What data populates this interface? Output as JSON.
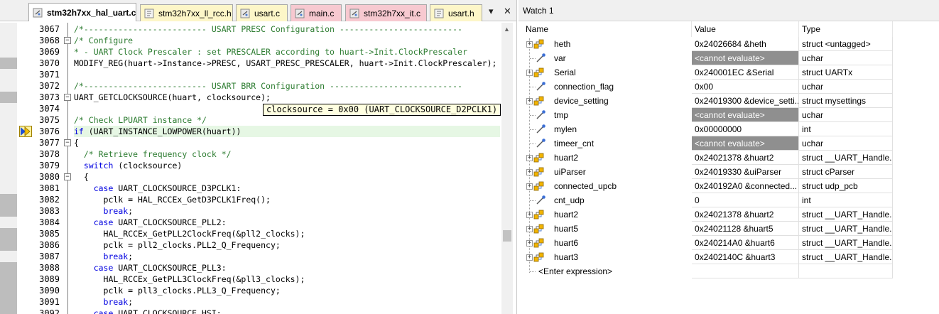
{
  "editor": {
    "tabs": [
      {
        "label": "stm32h7xx_hal_uart.c",
        "active": true
      },
      {
        "label": "stm32h7xx_ll_rcc.h",
        "active": false
      },
      {
        "label": "usart.c",
        "active": false
      },
      {
        "label": "main.c",
        "active": false
      },
      {
        "label": "stm32h7xx_it.c",
        "active": false
      },
      {
        "label": "usart.h",
        "active": false
      }
    ],
    "tab_tools": {
      "pin": "▾",
      "close": "✕"
    },
    "lines": [
      {
        "num": "3067",
        "text": "/*------------------------- USART PRESC Configuration -------------------------"
      },
      {
        "num": "3068",
        "text": "/* Configure"
      },
      {
        "num": "3069",
        "text": "* - UART Clock Prescaler : set PRESCALER according to huart->Init.ClockPrescaler"
      },
      {
        "num": "3070",
        "text": "MODIFY_REG(huart->Instance->PRESC, USART_PRESC_PRESCALER, huart->Init.ClockPrescaler);"
      },
      {
        "num": "3071",
        "text": ""
      },
      {
        "num": "3072",
        "text": "/*------------------------- USART BRR Configuration ---------------------------"
      },
      {
        "num": "3073",
        "text": "UART_GETCLOCKSOURCE(huart, clocksource);"
      },
      {
        "num": "3074",
        "text": ""
      },
      {
        "num": "3075",
        "text": "/* Check LPUART instance */"
      },
      {
        "num": "3076",
        "text": "if (UART_INSTANCE_LOWPOWER(huart))"
      },
      {
        "num": "3077",
        "text": "{"
      },
      {
        "num": "3078",
        "text": "  /* Retrieve frequency clock */"
      },
      {
        "num": "3079",
        "text": "  switch (clocksource)"
      },
      {
        "num": "3080",
        "text": "  {"
      },
      {
        "num": "3081",
        "text": "    case UART_CLOCKSOURCE_D3PCLK1:"
      },
      {
        "num": "3082",
        "text": "      pclk = HAL_RCCEx_GetD3PCLK1Freq();"
      },
      {
        "num": "3083",
        "text": "      break;"
      },
      {
        "num": "3084",
        "text": "    case UART_CLOCKSOURCE_PLL2:"
      },
      {
        "num": "3085",
        "text": "      HAL_RCCEx_GetPLL2ClockFreq(&pll2_clocks);"
      },
      {
        "num": "3086",
        "text": "      pclk = pll2_clocks.PLL2_Q_Frequency;"
      },
      {
        "num": "3087",
        "text": "      break;"
      },
      {
        "num": "3088",
        "text": "    case UART_CLOCKSOURCE_PLL3:"
      },
      {
        "num": "3089",
        "text": "      HAL_RCCEx_GetPLL3ClockFreq(&pll3_clocks);"
      },
      {
        "num": "3090",
        "text": "      pclk = pll3_clocks.PLL3_Q_Frequency;"
      },
      {
        "num": "3091",
        "text": "      break;"
      },
      {
        "num": "3092",
        "text": "    case UART_CLOCKSOURCE_HSI:"
      }
    ],
    "tooltip": "clocksource = 0x00 (UART_CLOCKSOURCE_D2PCLK1)"
  },
  "watch": {
    "title": "Watch 1",
    "columns": {
      "name": "Name",
      "value": "Value",
      "type": "Type"
    },
    "rows": [
      {
        "name": "heth",
        "value": "0x24026684 &heth",
        "type": "struct <untagged>",
        "expandable": true,
        "error": false
      },
      {
        "name": "var",
        "value": "<cannot evaluate>",
        "type": "uchar",
        "expandable": false,
        "error": true
      },
      {
        "name": "Serial",
        "value": "0x240001EC &Serial",
        "type": "struct UARTx",
        "expandable": true,
        "error": false
      },
      {
        "name": "connection_flag",
        "value": "0x00",
        "type": "uchar",
        "expandable": false,
        "error": false
      },
      {
        "name": "device_setting",
        "value": "0x24019300 &device_setti...",
        "type": "struct mysettings",
        "expandable": true,
        "error": false
      },
      {
        "name": "tmp",
        "value": "<cannot evaluate>",
        "type": "uchar",
        "expandable": false,
        "error": true
      },
      {
        "name": "mylen",
        "value": "0x00000000",
        "type": "int",
        "expandable": false,
        "error": false
      },
      {
        "name": "timeer_cnt",
        "value": "<cannot evaluate>",
        "type": "uchar",
        "expandable": false,
        "error": true
      },
      {
        "name": "huart2",
        "value": "0x24021378 &huart2",
        "type": "struct __UART_Handle...",
        "expandable": true,
        "error": false
      },
      {
        "name": "uiParser",
        "value": "0x24019330 &uiParser",
        "type": "struct cParser",
        "expandable": true,
        "error": false
      },
      {
        "name": "connected_upcb",
        "value": "0x240192A0 &connected...",
        "type": "struct udp_pcb",
        "expandable": true,
        "error": false
      },
      {
        "name": "cnt_udp",
        "value": "0",
        "type": "int",
        "expandable": false,
        "error": false
      },
      {
        "name": "huart2",
        "value": "0x24021378 &huart2",
        "type": "struct __UART_Handle...",
        "expandable": true,
        "error": false
      },
      {
        "name": "huart5",
        "value": "0x24021128 &huart5",
        "type": "struct __UART_Handle...",
        "expandable": true,
        "error": false
      },
      {
        "name": "huart6",
        "value": "0x240214A0 &huart6",
        "type": "struct __UART_Handle...",
        "expandable": true,
        "error": false
      },
      {
        "name": "huart3",
        "value": "0x2402140C &huart3",
        "type": "struct __UART_Handle...",
        "expandable": true,
        "error": false
      }
    ],
    "enter_expression": "<Enter expression>"
  }
}
